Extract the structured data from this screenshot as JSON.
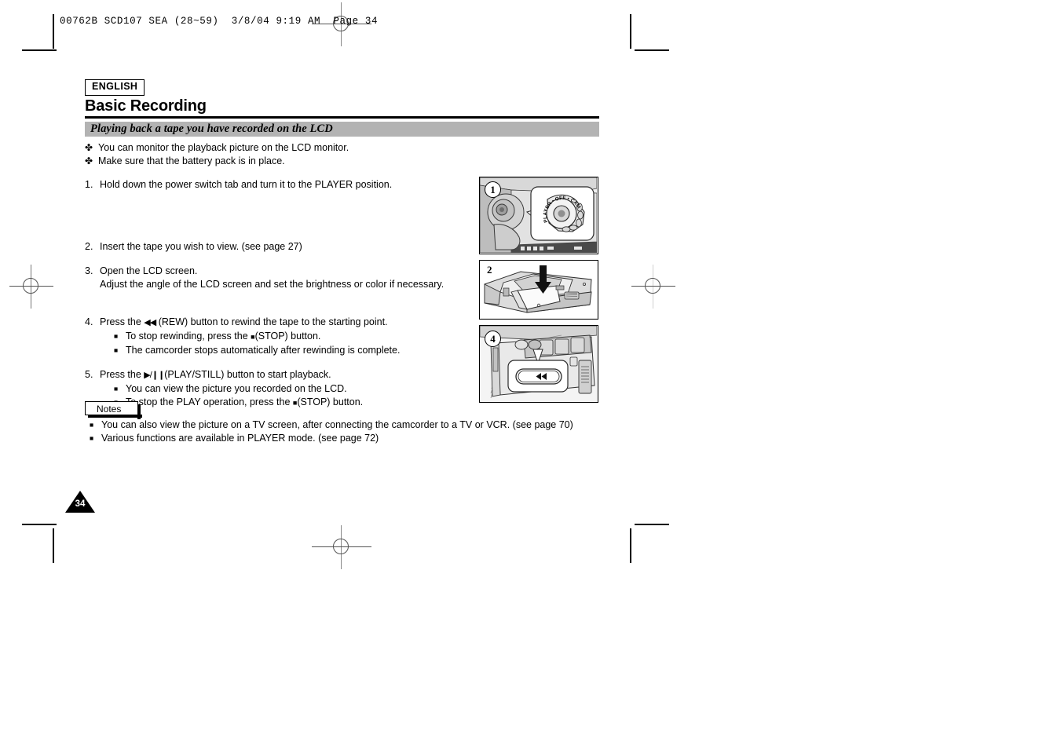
{
  "prepress": {
    "film_header": "00762B SCD107 SEA (28~59)  3/8/04 9:19 AM  Page 34"
  },
  "page": {
    "language_badge": "ENGLISH",
    "chapter_title": "Basic Recording",
    "section_heading": "Playing back a tape you have recorded on the LCD",
    "page_number": "34",
    "intro_bullets": [
      {
        "marker": "✤",
        "text": "You can monitor the playback picture on the LCD monitor."
      },
      {
        "marker": "✤",
        "text": "Make sure that the battery pack is in place."
      }
    ],
    "steps": [
      {
        "number": "1.",
        "lines": [
          "Hold down the power switch tab and turn it to the PLAYER position."
        ],
        "subs": []
      },
      {
        "number": "2.",
        "lines": [
          "Insert the tape you wish to view. (see page 27)"
        ],
        "subs": []
      },
      {
        "number": "3.",
        "lines": [
          "Open the LCD screen.",
          "Adjust the angle of the LCD screen and set the brightness or color if necessary."
        ],
        "subs": []
      },
      {
        "number": "4.",
        "prefix": "Press the",
        "glyph": "◀◀",
        "suffix": "(REW) button to rewind the tape to the starting point.",
        "lines": [],
        "subs": [
          {
            "marker": "■",
            "pre": "To stop rewinding, press the",
            "glyph": "■",
            "post": "(STOP) button."
          },
          {
            "marker": "■",
            "pre": "The camcorder stops automatically after rewinding is complete.",
            "glyph": "",
            "post": ""
          }
        ]
      },
      {
        "number": "5.",
        "prefix": "Press the",
        "glyph": "▶/❙❙",
        "suffix": "(PLAY/STILL) button to start playback.",
        "lines": [],
        "subs": [
          {
            "marker": "■",
            "pre": "You can view the picture you recorded on the LCD.",
            "glyph": "",
            "post": ""
          },
          {
            "marker": "■",
            "pre": "To stop the PLAY operation, press the",
            "glyph": "■",
            "post": "(STOP) button."
          }
        ]
      }
    ],
    "notes": {
      "label": "Notes",
      "items": [
        {
          "marker": "■",
          "text": "You can also view the picture on a TV screen, after connecting the camcorder to a TV or VCR. (see page 70)"
        },
        {
          "marker": "■",
          "text": "Various functions are available in PLAYER mode. (see page 72)"
        }
      ]
    },
    "figures": [
      {
        "number": "1",
        "caption_alt": "Camcorder power switch dial set to PLAYER",
        "dial_labels": [
          "PLAYER",
          "OFF",
          "CAMERA"
        ]
      },
      {
        "number": "2",
        "caption_alt": "Inserting a cassette tape into the open tape compartment"
      },
      {
        "number": "4",
        "caption_alt": "Close-up of the REW button on the camcorder body",
        "button_glyph": "◀◀"
      }
    ]
  },
  "colors": {
    "section_bar": "#b3b3b3",
    "illustration_light": "#e8e8e8",
    "illustration_mid": "#c9c9c9",
    "illustration_dark": "#9a9a9a",
    "ink": "#000000"
  }
}
